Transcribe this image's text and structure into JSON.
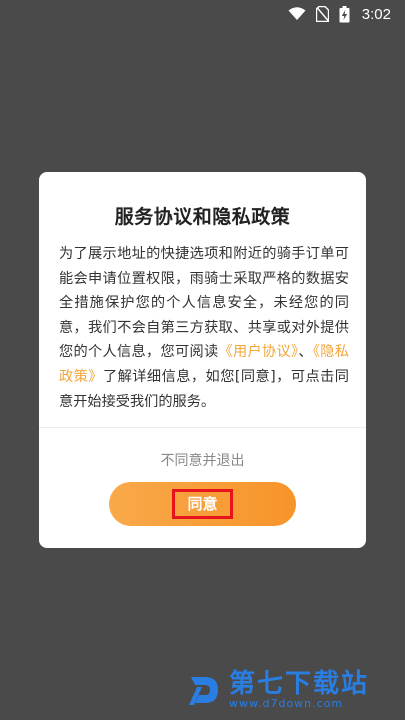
{
  "status_bar": {
    "time": "3:02",
    "icons": [
      "wifi-icon",
      "no-sim-icon",
      "battery-charging-icon"
    ]
  },
  "dialog": {
    "title": "服务协议和隐私政策",
    "body_before": "为了展示地址的快捷选项和附近的骑手订单可能会申请位置权限，雨骑士采取严格的数据安全措施保护您的个人信息安全，未经您的同意，我们不会自第三方获取、共享或对外提供您的个人信息，您可阅读",
    "user_agreement_link": "《用户协议》",
    "separator": "、",
    "privacy_policy_link": "《隐私政策》",
    "body_after": "了解详细信息，如您[同意]，可点击同意开始接受我们的服务。",
    "disagree_label": "不同意并退出",
    "agree_label": "同意"
  },
  "watermark": {
    "name": "第七下载站",
    "url": "www.d7down.com"
  },
  "colors": {
    "overlay": "#4a4a4a",
    "accent": "#f7942a",
    "link": "#f2a63c",
    "highlight_border": "#e8141c",
    "watermark": "#2a7de1"
  }
}
